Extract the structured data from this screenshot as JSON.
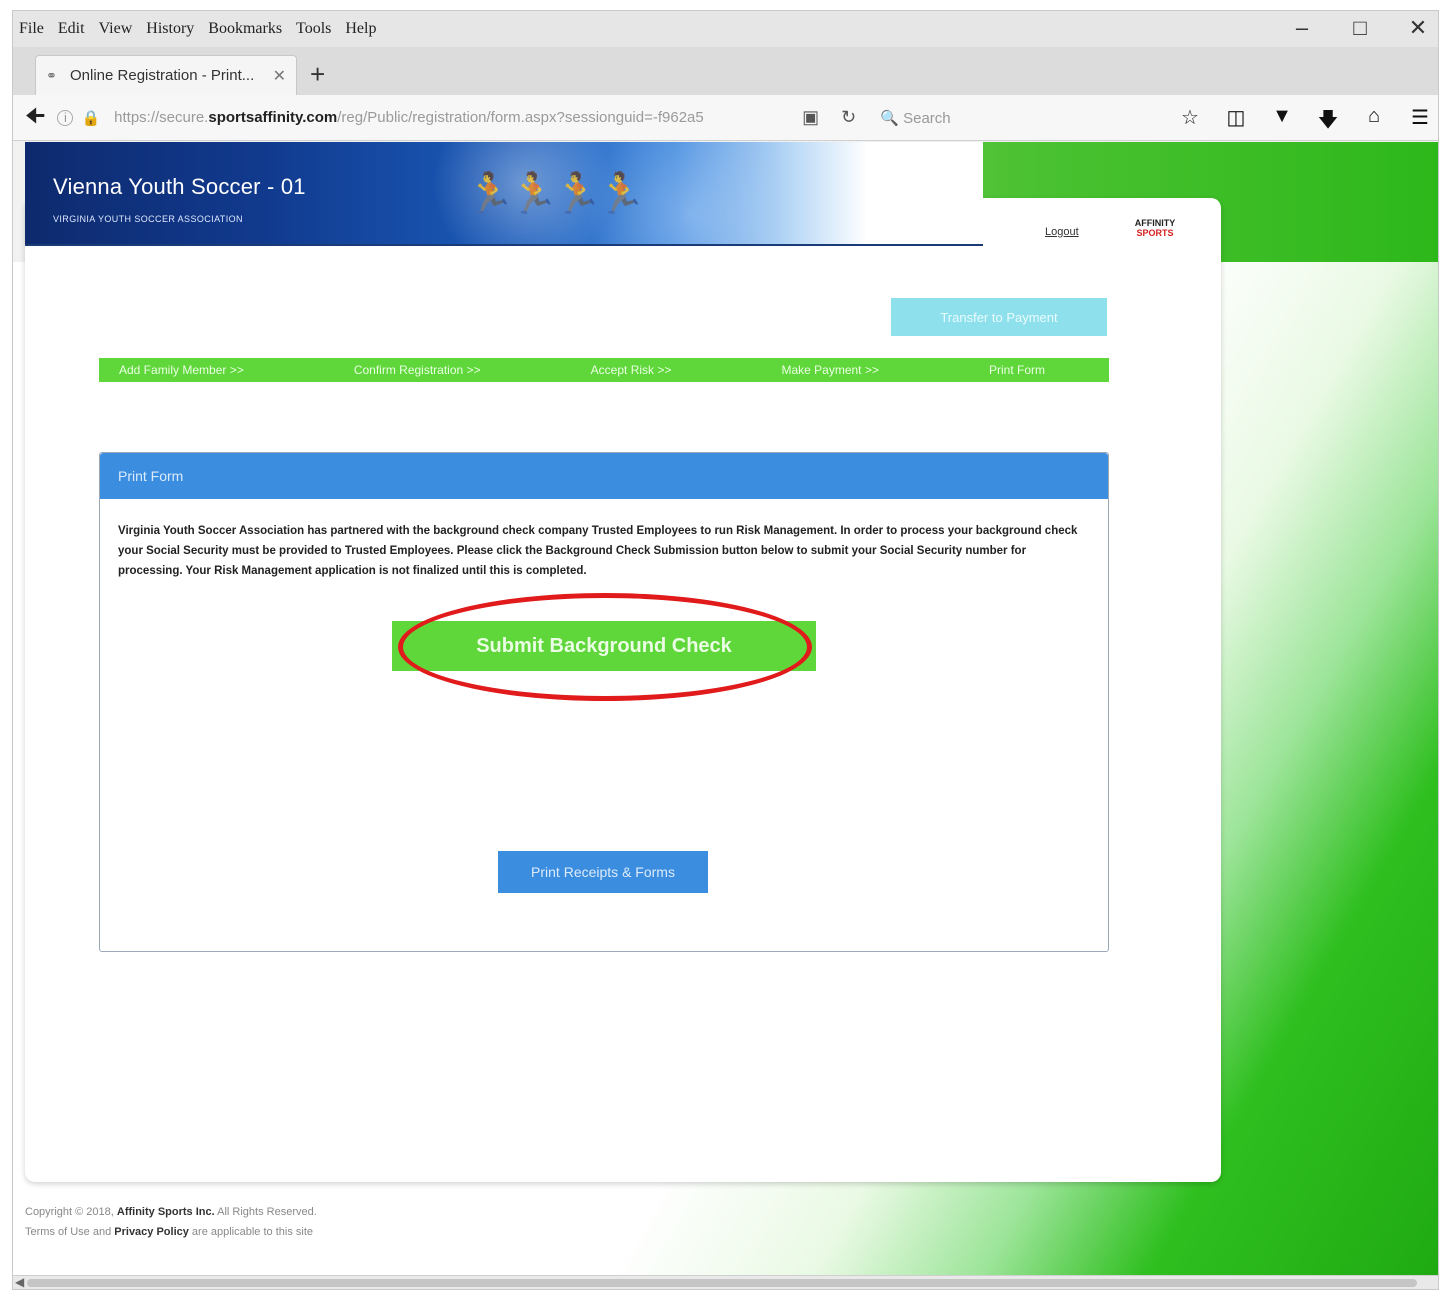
{
  "menubar": {
    "items": [
      "File",
      "Edit",
      "View",
      "History",
      "Bookmarks",
      "Tools",
      "Help"
    ]
  },
  "window_controls": {
    "minimize": "–",
    "maximize": "□",
    "close": "✕"
  },
  "tab": {
    "title": "Online Registration - Print...",
    "close": "✕",
    "new_tab": "+"
  },
  "navbar": {
    "url_prefix": "https://secure.",
    "url_domain": "sportsaffinity.com",
    "url_suffix": "/reg/Public/registration/form.aspx?sessionguid=-f962a5",
    "search_placeholder": "Search"
  },
  "banner": {
    "title": "Vienna Youth Soccer - 01",
    "subtitle": "VIRGINIA YOUTH SOCCER ASSOCIATION"
  },
  "header_links": {
    "logout": "Logout",
    "logo_top": "AFFINITY",
    "logo_bottom": "SPORTS"
  },
  "top_button": {
    "label": "Transfer to Payment"
  },
  "steps": [
    "Add Family Member >>",
    "Confirm Registration >>",
    "Accept Risk >>",
    "Make Payment >>",
    "Print Form"
  ],
  "panel": {
    "heading": "Print Form",
    "body": "Virginia Youth Soccer Association has partnered with the background check company Trusted Employees to run Risk Management. In order to process your background check your Social Security must be provided to Trusted Employees. Please click the Background Check Submission button below to submit your Social Security number for processing. Your Risk Management application is not finalized until this is completed.",
    "submit_button": "Submit Background Check",
    "print_button": "Print Receipts & Forms"
  },
  "footer": {
    "line1_pre": "Copyright © 2018, ",
    "line1_bold": "Affinity Sports Inc.",
    "line1_post": " All Rights Reserved.",
    "line2_pre": "Terms of Use and ",
    "line2_bold": "Privacy Policy",
    "line2_post": " are applicable to this site"
  },
  "colors": {
    "step_green": "#5fd63a",
    "panel_blue": "#3b8de0",
    "highlight_red": "#e11b1b"
  }
}
